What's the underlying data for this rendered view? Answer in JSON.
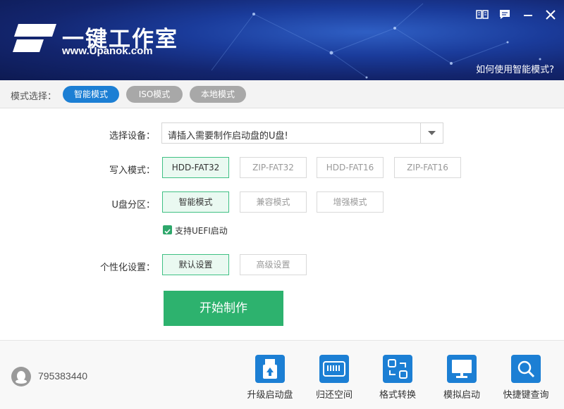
{
  "header": {
    "brand": "一键工作室",
    "url": "www.Upanok.com",
    "help_link": "如何使用智能模式?"
  },
  "window_controls": [
    "book-icon",
    "message-icon",
    "minimize-icon",
    "close-icon"
  ],
  "mode_bar": {
    "label": "模式选择：",
    "tabs": [
      {
        "label": "智能模式",
        "selected": true
      },
      {
        "label": "ISO模式",
        "selected": false
      },
      {
        "label": "本地模式",
        "selected": false
      }
    ]
  },
  "form": {
    "device_label": "选择设备：",
    "device_value": "请插入需要制作启动盘的U盘!",
    "write_label": "写入模式：",
    "write_options": [
      "HDD-FAT32",
      "ZIP-FAT32",
      "HDD-FAT16",
      "ZIP-FAT16"
    ],
    "partition_label": "U盘分区：",
    "partition_options": [
      "智能模式",
      "兼容模式",
      "增强模式"
    ],
    "uefi_label": "支持UEFI启动",
    "uefi_checked": true,
    "personal_label": "个性化设置：",
    "personal_options": [
      "默认设置",
      "高级设置"
    ],
    "start_button": "开始制作"
  },
  "footer": {
    "qq": "795383440",
    "tools": [
      "升级启动盘",
      "归还空间",
      "格式转换",
      "模拟启动",
      "快捷键查询"
    ]
  },
  "colors": {
    "accent_blue": "#1c7fd4",
    "accent_green": "#2db26e",
    "header_dark": "#13256e"
  }
}
